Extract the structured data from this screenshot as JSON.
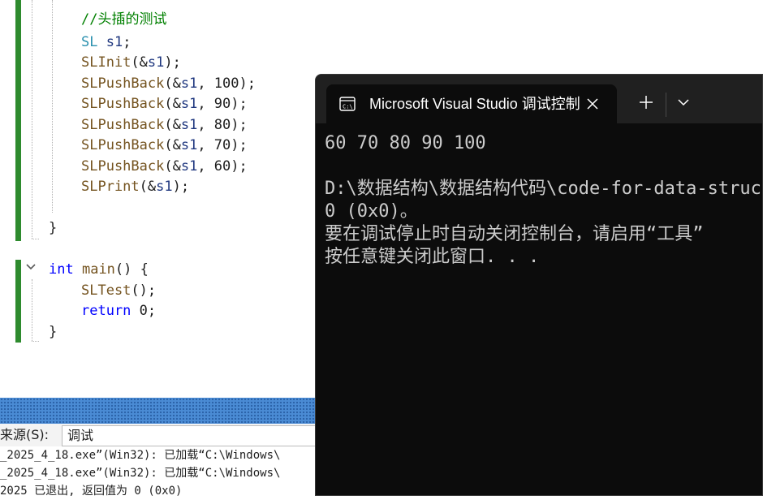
{
  "editor": {
    "lines": [
      {
        "tokens": [
          {
            "t": "//头插的测试",
            "c": "comment"
          }
        ]
      },
      {
        "tokens": [
          {
            "t": "SL",
            "c": "type"
          },
          {
            "t": " ",
            "c": "text"
          },
          {
            "t": "s1",
            "c": "var"
          },
          {
            "t": ";",
            "c": "text"
          }
        ]
      },
      {
        "tokens": [
          {
            "t": "SLInit",
            "c": "func"
          },
          {
            "t": "(&",
            "c": "text"
          },
          {
            "t": "s1",
            "c": "var"
          },
          {
            "t": ");",
            "c": "text"
          }
        ]
      },
      {
        "tokens": [
          {
            "t": "SLPushBack",
            "c": "func"
          },
          {
            "t": "(&",
            "c": "text"
          },
          {
            "t": "s1",
            "c": "var"
          },
          {
            "t": ", 100);",
            "c": "text"
          }
        ]
      },
      {
        "tokens": [
          {
            "t": "SLPushBack",
            "c": "func"
          },
          {
            "t": "(&",
            "c": "text"
          },
          {
            "t": "s1",
            "c": "var"
          },
          {
            "t": ", 90);",
            "c": "text"
          }
        ]
      },
      {
        "tokens": [
          {
            "t": "SLPushBack",
            "c": "func"
          },
          {
            "t": "(&",
            "c": "text"
          },
          {
            "t": "s1",
            "c": "var"
          },
          {
            "t": ", 80);",
            "c": "text"
          }
        ]
      },
      {
        "tokens": [
          {
            "t": "SLPushBack",
            "c": "func"
          },
          {
            "t": "(&",
            "c": "text"
          },
          {
            "t": "s1",
            "c": "var"
          },
          {
            "t": ", 70);",
            "c": "text"
          }
        ]
      },
      {
        "tokens": [
          {
            "t": "SLPushBack",
            "c": "func"
          },
          {
            "t": "(&",
            "c": "text"
          },
          {
            "t": "s1",
            "c": "var"
          },
          {
            "t": ", 60);",
            "c": "text"
          }
        ]
      },
      {
        "tokens": [
          {
            "t": "SLPrint",
            "c": "func"
          },
          {
            "t": "(&",
            "c": "text"
          },
          {
            "t": "s1",
            "c": "var"
          },
          {
            "t": ");",
            "c": "text"
          }
        ]
      },
      {
        "tokens": []
      },
      {
        "tokens": [
          {
            "t": "}",
            "c": "text"
          }
        ]
      },
      {
        "tokens": []
      },
      {
        "tokens": [
          {
            "t": "int",
            "c": "kw"
          },
          {
            "t": " ",
            "c": "text"
          },
          {
            "t": "main",
            "c": "func"
          },
          {
            "t": "() {",
            "c": "text"
          }
        ]
      },
      {
        "tokens": [
          {
            "t": "SLTest",
            "c": "func"
          },
          {
            "t": "();",
            "c": "text"
          }
        ]
      },
      {
        "tokens": [
          {
            "t": "return",
            "c": "kw"
          },
          {
            "t": " 0;",
            "c": "text"
          }
        ]
      },
      {
        "tokens": [
          {
            "t": "}",
            "c": "text"
          }
        ]
      }
    ]
  },
  "output": {
    "source_label": "来源(S):",
    "source_value": "调试",
    "lines": [
      "_2025_4_18.exe”(Win32): 已加载“C:\\Windows\\",
      "_2025_4_18.exe”(Win32): 已加载“C:\\Windows\\",
      "2025 已退出, 返回值为 0 (0x0)"
    ]
  },
  "terminal": {
    "tab_title": "Microsoft Visual Studio 调试控制台",
    "icons": {
      "tab": "terminal-icon",
      "close": "close-icon",
      "new": "plus-icon",
      "menu": "chevron-down-icon"
    },
    "lines": [
      "60 70 80 90 100",
      "",
      "D:\\数据结构\\数据结构代码\\code-for-data-structure",
      "0 (0x0)。",
      "要在调试停止时自动关闭控制台，请启用“工具”",
      "按任意键关闭此窗口. . ."
    ]
  },
  "colors": {
    "comment": "#008000",
    "keyword": "#0000ff",
    "type": "#2b91af",
    "function": "#74531f",
    "variable": "#1f377f",
    "change_bar": "#2e8b2e",
    "terminal_bg": "#0c0c0c",
    "terminal_text": "#cccccc"
  }
}
